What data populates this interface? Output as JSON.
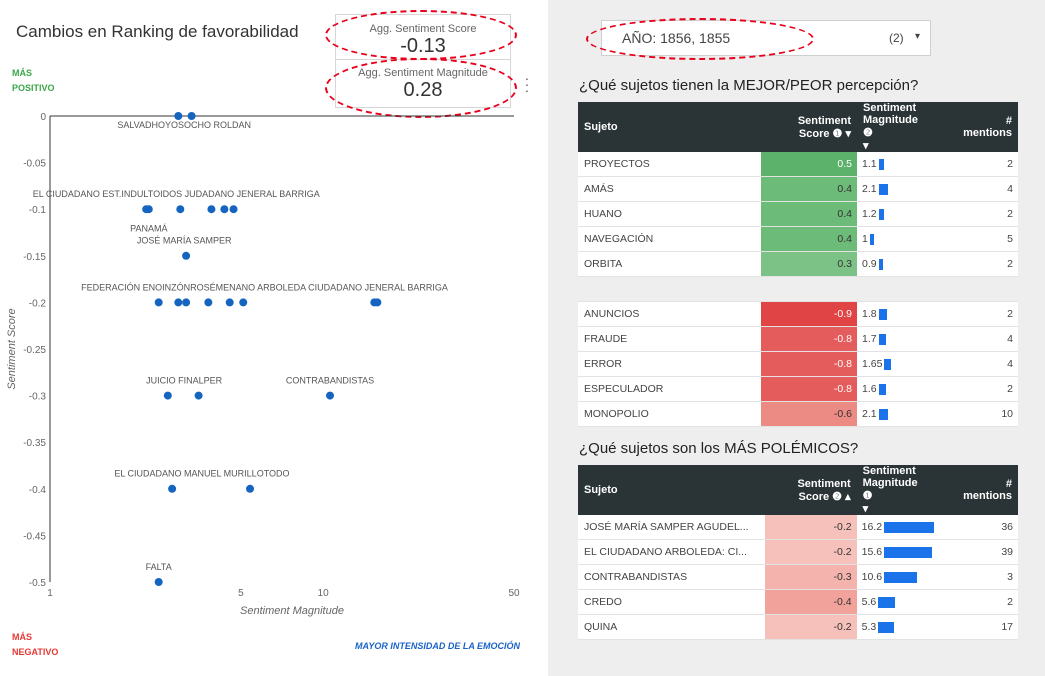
{
  "left_panel": {
    "title": "Cambios en Ranking de favorabilidad",
    "kpi_score_label": "Agg. Sentiment Score",
    "kpi_score_value": "-0.13",
    "kpi_magnitude_label": "Agg. Sentiment Magnitude",
    "kpi_magnitude_value": "0.28",
    "corner_top_1": "MÁS",
    "corner_top_2": "POSITIVO",
    "corner_bottom_1": "MÁS",
    "corner_bottom_2": "NEGATIVO",
    "corner_right": "MAYOR INTENSIDAD DE LA EMOCIÓN",
    "colors": {
      "positive": "#3aa74a",
      "negative": "#e53935",
      "accent": "#1a63c7",
      "point": "#1565c0"
    }
  },
  "chart_data": {
    "type": "scatter",
    "xlabel": "Sentiment Magnitude",
    "ylabel": "Sentiment Score",
    "xscale": "log",
    "xlim": [
      1,
      50
    ],
    "ylim": [
      -0.5,
      0
    ],
    "x_ticks": [
      "1",
      "5",
      "10",
      "50"
    ],
    "x_tick_values": [
      1,
      5,
      10,
      50
    ],
    "y_ticks": [
      "0",
      "-0.05",
      "-0.1",
      "-0.15",
      "-0.2",
      "-0.25",
      "-0.3",
      "-0.35",
      "-0.4",
      "-0.45",
      "-0.5"
    ],
    "y_tick_values": [
      0,
      -0.05,
      -0.1,
      -0.15,
      -0.2,
      -0.25,
      -0.3,
      -0.35,
      -0.4,
      -0.45,
      -0.5
    ],
    "grid": false,
    "points": [
      {
        "x": 2.95,
        "y": 0.0
      },
      {
        "x": 3.3,
        "y": 0.0
      },
      {
        "x": 2.25,
        "y": -0.1
      },
      {
        "x": 2.3,
        "y": -0.1
      },
      {
        "x": 3.0,
        "y": -0.1
      },
      {
        "x": 3.9,
        "y": -0.1
      },
      {
        "x": 4.35,
        "y": -0.1
      },
      {
        "x": 4.7,
        "y": -0.1
      },
      {
        "x": 3.15,
        "y": -0.15
      },
      {
        "x": 2.5,
        "y": -0.2
      },
      {
        "x": 2.95,
        "y": -0.2
      },
      {
        "x": 3.15,
        "y": -0.2
      },
      {
        "x": 3.8,
        "y": -0.2
      },
      {
        "x": 4.55,
        "y": -0.2
      },
      {
        "x": 5.1,
        "y": -0.2
      },
      {
        "x": 15.4,
        "y": -0.2
      },
      {
        "x": 15.8,
        "y": -0.2
      },
      {
        "x": 2.7,
        "y": -0.3
      },
      {
        "x": 3.5,
        "y": -0.3
      },
      {
        "x": 10.6,
        "y": -0.3
      },
      {
        "x": 2.8,
        "y": -0.4
      },
      {
        "x": 5.4,
        "y": -0.4
      },
      {
        "x": 2.5,
        "y": -0.5
      }
    ],
    "labels": [
      {
        "text": "SALVADHOYOSOCHO ROLDAN",
        "x": 3.1,
        "y": -0.013
      },
      {
        "text": "EL CIUDADANO EST.INDULTOIDOS JUDADANO JENERAL BARRIGA",
        "x": 2.9,
        "y": -0.087
      },
      {
        "text": "PANAMÁ",
        "x": 2.3,
        "y": -0.124
      },
      {
        "text": "JOSÉ MARÍA SAMPER",
        "x": 3.1,
        "y": -0.137
      },
      {
        "text": "FEDERACIÓN ENOINZÓNROSÉMENANO ARBOLEDA CIUDADANO JENERAL BARRIGA",
        "x": 6.1,
        "y": -0.187
      },
      {
        "text": "JUICIO FINALPER",
        "x": 3.1,
        "y": -0.287
      },
      {
        "text": "CONTRABANDISTAS",
        "x": 10.6,
        "y": -0.287
      },
      {
        "text": "EL CIUDADANO MANUEL MURILLOTODO",
        "x": 3.6,
        "y": -0.387
      },
      {
        "text": "FALTA",
        "x": 2.5,
        "y": -0.487
      }
    ]
  },
  "right_panel": {
    "year_filter_label": "AÑO: 1856, 1855",
    "year_filter_count": "(2)",
    "year_filter_arrow": "▾",
    "best_title": "¿Qué sujetos tienen la MEJOR/PEOR percepción?",
    "polemic_title": "¿Qué sujetos son los MÁS POLÉMICOS?",
    "headers": {
      "subject": "Sujeto",
      "score_1": "Sentiment",
      "score_2": "Score",
      "magnitude_1": "Sentiment",
      "magnitude_2": "Magnitude",
      "mentions_1": "#",
      "mentions_2": "mentions"
    },
    "table1_score_sort": "▾",
    "table2_score_sort": "▴",
    "magnitude_sort": "▾",
    "help_icon": "❶",
    "help_icon_2": "❷",
    "best_rows": [
      {
        "subject": "PROYECTOS",
        "score": "0.5",
        "score_value": 0.5,
        "magnitude": "1.1",
        "magnitude_value": 1.1,
        "mentions": "2"
      },
      {
        "subject": "AMÁS",
        "score": "0.4",
        "score_value": 0.4,
        "magnitude": "2.1",
        "magnitude_value": 2.1,
        "mentions": "4"
      },
      {
        "subject": "HUANO",
        "score": "0.4",
        "score_value": 0.4,
        "magnitude": "1.2",
        "magnitude_value": 1.2,
        "mentions": "2"
      },
      {
        "subject": "NAVEGACIÓN",
        "score": "0.4",
        "score_value": 0.4,
        "magnitude": "1",
        "magnitude_value": 1.0,
        "mentions": "5"
      },
      {
        "subject": "ORBITA",
        "score": "0.3",
        "score_value": 0.3,
        "magnitude": "0.9",
        "magnitude_value": 0.9,
        "mentions": "2"
      }
    ],
    "worst_rows": [
      {
        "subject": "ANUNCIOS",
        "score": "-0.9",
        "score_value": -0.9,
        "magnitude": "1.8",
        "magnitude_value": 1.8,
        "mentions": "2"
      },
      {
        "subject": "FRAUDE",
        "score": "-0.8",
        "score_value": -0.8,
        "magnitude": "1.7",
        "magnitude_value": 1.7,
        "mentions": "4"
      },
      {
        "subject": "ERROR",
        "score": "-0.8",
        "score_value": -0.8,
        "magnitude": "1.65",
        "magnitude_value": 1.65,
        "mentions": "4"
      },
      {
        "subject": "ESPECULADOR",
        "score": "-0.8",
        "score_value": -0.8,
        "magnitude": "1.6",
        "magnitude_value": 1.6,
        "mentions": "2"
      },
      {
        "subject": "MONOPOLIO",
        "score": "-0.6",
        "score_value": -0.6,
        "magnitude": "2.1",
        "magnitude_value": 2.1,
        "mentions": "10"
      }
    ],
    "polemic_rows": [
      {
        "subject": "JOSÉ MARÍA SAMPER AGUDEL...",
        "score": "-0.2",
        "score_value": -0.2,
        "magnitude": "16.2",
        "magnitude_value": 16.2,
        "mentions": "36"
      },
      {
        "subject": "EL CIUDADANO ARBOLEDA: CI...",
        "score": "-0.2",
        "score_value": -0.2,
        "magnitude": "15.6",
        "magnitude_value": 15.6,
        "mentions": "39"
      },
      {
        "subject": "CONTRABANDISTAS",
        "score": "-0.3",
        "score_value": -0.3,
        "magnitude": "10.6",
        "magnitude_value": 10.6,
        "mentions": "3"
      },
      {
        "subject": "CREDO",
        "score": "-0.4",
        "score_value": -0.4,
        "magnitude": "5.6",
        "magnitude_value": 5.6,
        "mentions": "2"
      },
      {
        "subject": "QUINA",
        "score": "-0.2",
        "score_value": -0.2,
        "magnitude": "5.3",
        "magnitude_value": 5.3,
        "mentions": "17"
      }
    ]
  }
}
